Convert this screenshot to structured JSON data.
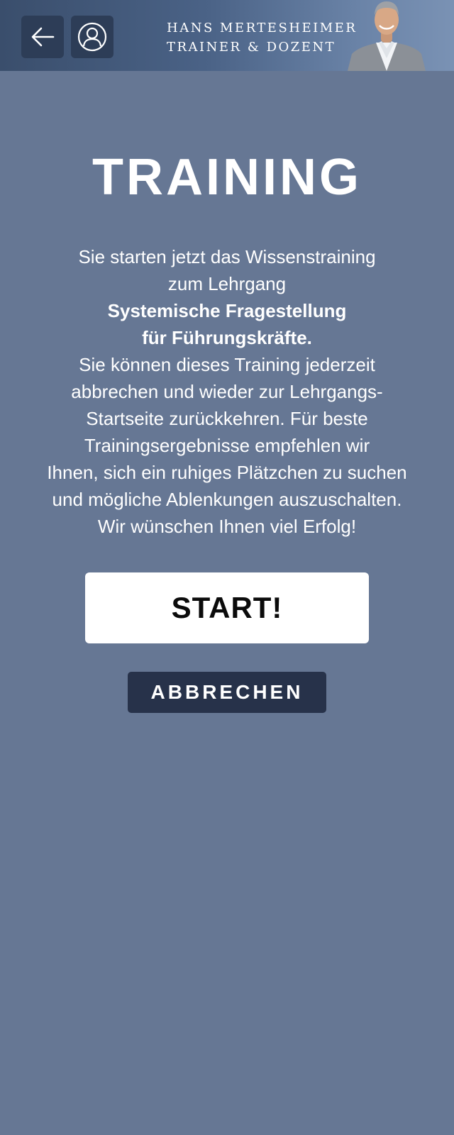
{
  "header": {
    "back_icon": "arrow-left-icon",
    "profile_icon": "user-profile-icon",
    "brand_name": "HANS MERTESHEIMER",
    "brand_subtitle": "TRAINER & DOZENT",
    "portrait": "trainer-portrait"
  },
  "main": {
    "title": "TRAINING",
    "intro_lines": [
      "Sie starten jetzt das Wissenstraining",
      "zum Lehrgang"
    ],
    "course_lines": [
      "Systemische Fragestellung",
      "für Führungskräfte."
    ],
    "body_lines": [
      "Sie können dieses Training jederzeit",
      "abbrechen und wieder zur Lehrgangs-",
      "Startseite zurückkehren. Für beste",
      "Trainingsergebnisse empfehlen wir",
      "Ihnen, sich ein ruhiges Plätzchen zu suchen",
      "und mögliche Ablenkungen auszuschalten.",
      "Wir wünschen Ihnen viel Erfolg!"
    ]
  },
  "actions": {
    "start_label": "START!",
    "cancel_label": "ABBRECHEN"
  },
  "colors": {
    "background": "#667794",
    "button_dark": "#27324a",
    "header_button": "#2d3d57",
    "start_bg": "#ffffff",
    "start_text": "#0b0b0b"
  }
}
